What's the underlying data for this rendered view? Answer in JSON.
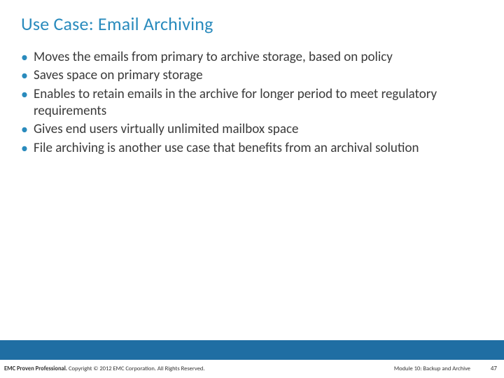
{
  "title": "Use Case: Email Archiving",
  "bullets": [
    "Moves the emails from primary to archive storage, based on policy",
    "Saves space on primary storage",
    "Enables to retain emails in the archive for longer period to meet regulatory requirements",
    "Gives end users virtually unlimited mailbox space",
    "File archiving is another use case that benefits from an archival solution"
  ],
  "footer": {
    "brand": "EMC Proven Professional.",
    "copyright": " Copyright © 2012 EMC Corporation. All Rights Reserved.",
    "module": "Module 10: Backup and Archive",
    "page": "47"
  }
}
